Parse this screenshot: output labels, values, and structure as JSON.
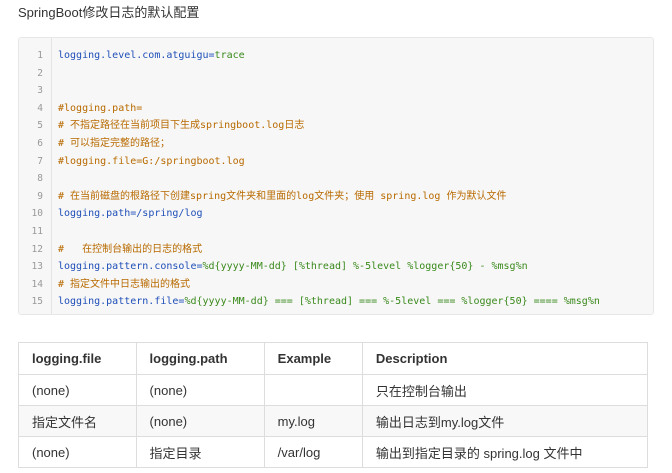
{
  "heading": "SpringBoot修改日志的默认配置",
  "code_lines": [
    {
      "num": "1",
      "segments": [
        {
          "t": "logging.level.com.atguigu",
          "c": "k"
        },
        {
          "t": "=",
          "c": "k"
        },
        {
          "t": "trace",
          "c": "v"
        }
      ]
    },
    {
      "num": "2",
      "segments": []
    },
    {
      "num": "3",
      "segments": []
    },
    {
      "num": "4",
      "segments": [
        {
          "t": "#logging.path=",
          "c": "c"
        }
      ]
    },
    {
      "num": "5",
      "segments": [
        {
          "t": "# 不指定路径在当前项目下生成springboot.log日志",
          "c": "c"
        }
      ]
    },
    {
      "num": "6",
      "segments": [
        {
          "t": "# 可以指定完整的路径；",
          "c": "c"
        }
      ]
    },
    {
      "num": "7",
      "segments": [
        {
          "t": "#logging.file=G:/springboot.log",
          "c": "c"
        }
      ]
    },
    {
      "num": "8",
      "segments": []
    },
    {
      "num": "9",
      "segments": [
        {
          "t": "# 在当前磁盘的根路径下创建spring文件夹和里面的log文件夹；使用 spring.log 作为默认文件",
          "c": "c"
        }
      ]
    },
    {
      "num": "10",
      "segments": [
        {
          "t": "logging.path",
          "c": "k"
        },
        {
          "t": "=",
          "c": "k"
        },
        {
          "t": "/spring/log",
          "c": "k"
        }
      ]
    },
    {
      "num": "11",
      "segments": []
    },
    {
      "num": "12",
      "segments": [
        {
          "t": "#   在控制台输出的日志的格式",
          "c": "c"
        }
      ]
    },
    {
      "num": "13",
      "segments": [
        {
          "t": "logging.pattern.console",
          "c": "k"
        },
        {
          "t": "=",
          "c": "k"
        },
        {
          "t": "%d{yyyy-MM-dd} [%thread] %-5level %logger{50} - %msg%n",
          "c": "v"
        }
      ]
    },
    {
      "num": "14",
      "segments": [
        {
          "t": "# 指定文件中日志输出的格式",
          "c": "c"
        }
      ]
    },
    {
      "num": "15",
      "segments": [
        {
          "t": "logging.pattern.file",
          "c": "k"
        },
        {
          "t": "=",
          "c": "k"
        },
        {
          "t": "%d{yyyy-MM-dd} === [%thread] === %-5level === %logger{50} ==== %msg%n",
          "c": "v"
        }
      ]
    }
  ],
  "table": {
    "headers": [
      "logging.file",
      "logging.path",
      "Example",
      "Description"
    ],
    "rows": [
      [
        "(none)",
        "(none)",
        "",
        "只在控制台输出"
      ],
      [
        "指定文件名",
        "(none)",
        "my.log",
        "输出日志到my.log文件"
      ],
      [
        "(none)",
        "指定目录",
        "/var/log",
        "输出到指定目录的 spring.log 文件中"
      ]
    ]
  }
}
